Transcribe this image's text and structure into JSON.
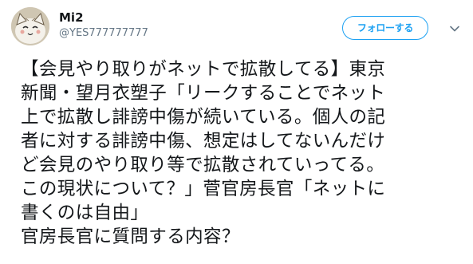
{
  "user": {
    "display_name": "Mi2",
    "screen_name": "@YES777777777"
  },
  "actions": {
    "follow_label": "フォローする",
    "menu_icon": "chevron-down-icon"
  },
  "colors": {
    "accent": "#1da1f2",
    "text": "#14171a",
    "secondary": "#657786"
  },
  "tweet": {
    "lines": [
      "【会見やり取りがネットで拡散してる】東京",
      "新聞・望月衣塑子「リークすることでネット",
      "上で拡散し誹謗中傷が続いている。個人の記",
      "者に対する誹謗中傷、想定はしてないんだけ",
      "ど会見のやり取り等で拡散されていってる。",
      "この現状について？」菅官房長官「ネットに",
      "書くのは自由」",
      "官房長官に質問する内容？"
    ]
  }
}
